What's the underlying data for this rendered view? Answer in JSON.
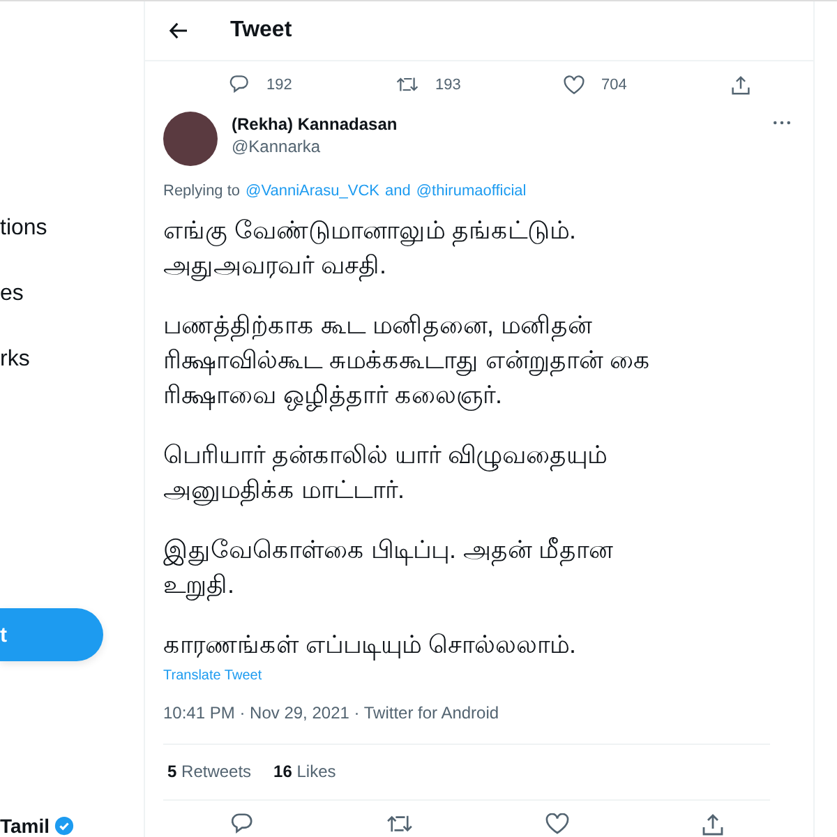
{
  "sidebar": {
    "items": [
      {
        "label": "tions"
      },
      {
        "label": "es"
      },
      {
        "label": "rks"
      }
    ],
    "tweet_button": "t",
    "account": {
      "name": "Tamil",
      "verified": true
    }
  },
  "header": {
    "title": "Tweet"
  },
  "previous_tweet": {
    "replies": "192",
    "retweets": "193",
    "likes": "704"
  },
  "tweet": {
    "name": "(Rekha) Kannadasan",
    "handle": "@Kannarka",
    "replying_label": "Replying to",
    "mentions": [
      "@VanniArasu_VCK",
      "@thirumaofficial"
    ],
    "mention_joiner": "and",
    "paragraphs": [
      "எங்கு வேண்டுமானாலும் தங்கட்டும்.\nஅதுஅவரவர் வசதி.",
      "பணத்திற்காக கூட மனிதனை, மனிதன்\nரிக்ஷாவில்கூட சுமக்ககூடாது என்றுதான் கை\nரிக்ஷாவை ஒழித்தார் கலைஞர்.",
      "பெரியார் தன்காலில் யார் விழுவதையும்\nஅனுமதிக்க மாட்டார்.",
      "இதுவேகொள்கை பிடிப்பு. அதன் மீதான\nஉறுதி.",
      "காரணங்கள் எப்படியும் சொல்லலாம்."
    ],
    "translate": "Translate Tweet",
    "timestamp": "10:41 PM · Nov 29, 2021 · Twitter for Android",
    "stats": [
      {
        "count": "5",
        "label": "Retweets"
      },
      {
        "count": "16",
        "label": "Likes"
      }
    ]
  }
}
